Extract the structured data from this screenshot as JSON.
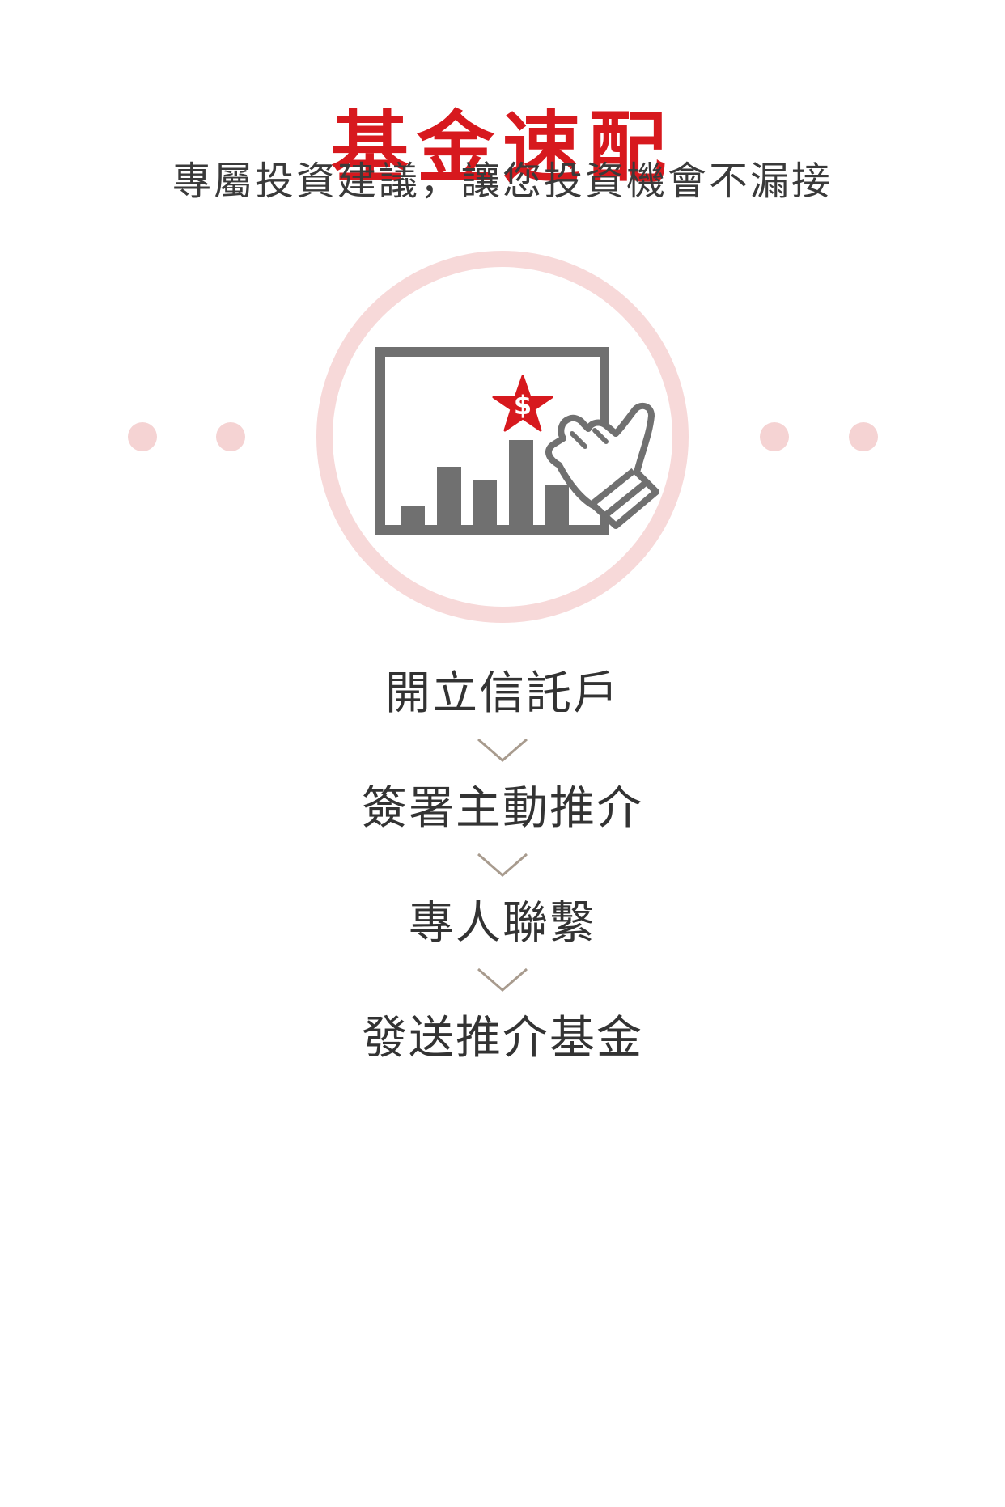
{
  "header": {
    "title": "基金速配",
    "subtitle": "專屬投資建議，讓您投資機會不漏接"
  },
  "hero": {
    "icon": "chart-board-with-pointing-hand-icon",
    "badge_symbol": "$"
  },
  "steps": [
    {
      "label": "開立信託戶"
    },
    {
      "label": "簽署主動推介"
    },
    {
      "label": "專人聯繫"
    },
    {
      "label": "發送推介基金"
    }
  ],
  "colors": {
    "brand_red": "#d7191e",
    "ring_pink": "#f7d9d9",
    "dot_pink": "#f5d3d3",
    "icon_gray": "#707070",
    "arrow_tan": "#a89b8e",
    "text_dark": "#333333"
  }
}
